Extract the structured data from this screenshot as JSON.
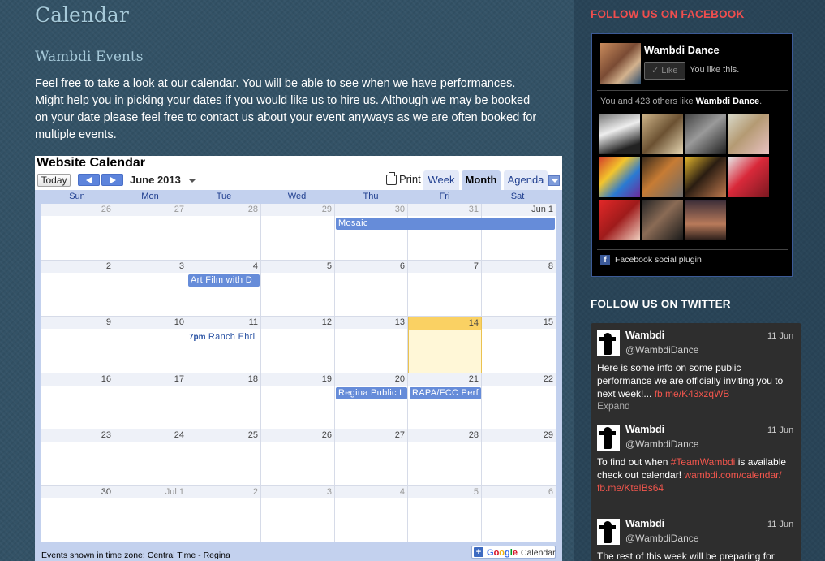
{
  "page": {
    "title": "Calendar",
    "section_title": "Wambdi Events",
    "intro_lines": [
      "Feel free to take a look at our calendar. You will be able to see when we have performances.",
      "Might help you in picking your dates if you would like us to hire us. Although we may be booked",
      "on your date please feel free to contact us about your event anyways as we are often booked for",
      "multiple events."
    ]
  },
  "calendar": {
    "title": "Website Calendar",
    "today_label": "Today",
    "month_label": "June 2013",
    "print_label": "Print",
    "view_tabs": [
      "Week",
      "Month",
      "Agenda"
    ],
    "active_view": "Month",
    "days_of_week": [
      "Sun",
      "Mon",
      "Tue",
      "Wed",
      "Thu",
      "Fri",
      "Sat"
    ],
    "weeks": [
      [
        "26",
        "27",
        "28",
        "29",
        "30",
        "31",
        "Jun 1"
      ],
      [
        "2",
        "3",
        "4",
        "5",
        "6",
        "7",
        "8"
      ],
      [
        "9",
        "10",
        "11",
        "12",
        "13",
        "14",
        "15"
      ],
      [
        "16",
        "17",
        "18",
        "19",
        "20",
        "21",
        "22"
      ],
      [
        "23",
        "24",
        "25",
        "26",
        "27",
        "28",
        "29"
      ],
      [
        "30",
        "Jul 1",
        "2",
        "3",
        "4",
        "5",
        "6"
      ]
    ],
    "today": "14",
    "events": {
      "mosaic": "Mosaic",
      "art_film": "Art Film with D",
      "ranch_time": "7pm",
      "ranch_title": "Ranch Ehrl",
      "regina_public": "Regina Public L",
      "rapa": "RAPA/FCC Perf"
    },
    "timezone_note": "Events shown in time zone: Central Time - Regina",
    "gcal_letters": [
      "G",
      "o",
      "o",
      "g",
      "l",
      "e"
    ],
    "gcal_suffix": "Calendar",
    "colors": {
      "event": "#668cd9",
      "header": "#c3d1ee",
      "today": "#fad163"
    }
  },
  "sidebar": {
    "facebook_heading": "FOLLOW US ON FACEBOOK",
    "facebook": {
      "page_name": "Wambdi Dance",
      "like_button": "Like",
      "like_status": "You like this.",
      "count_prefix": "You and 423 others like",
      "count_page": "Wambdi Dance",
      "count_suffix": ".",
      "plugin_label": "Facebook social plugin",
      "plugin_icon": "f"
    },
    "twitter_heading": "FOLLOW US ON TWITTER",
    "tweets": [
      {
        "name": "Wambdi",
        "handle": "@WambdiDance",
        "date": "11 Jun",
        "text": "Here is some info on some public performance we are officially inviting you to next week!...",
        "link1": "fb.me/K43xzqWB",
        "expand": "Expand"
      },
      {
        "name": "Wambdi",
        "handle": "@WambdiDance",
        "date": "11 Jun",
        "text_a": "To find out when",
        "hashtag": "#TeamWambdi",
        "text_b": "is available check out calendar!",
        "link1": "wambdi.com/calendar/",
        "link2": "fb.me/KteIBs64"
      },
      {
        "name": "Wambdi",
        "handle": "@WambdiDance",
        "date": "11 Jun",
        "text": "The rest of this week will be preparing for"
      }
    ],
    "colors": {
      "heading_facebook": "#ef4e4e",
      "heading_twitter": "#ffffff",
      "tweet_link": "#f2564d"
    }
  }
}
